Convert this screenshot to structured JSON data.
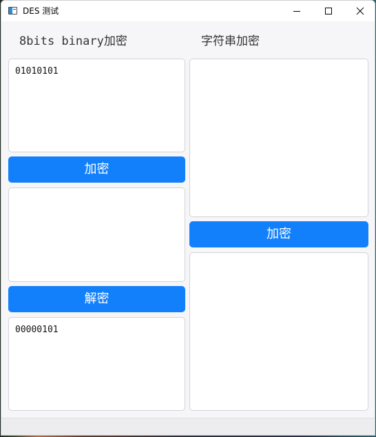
{
  "window": {
    "title": "DES 测试"
  },
  "binary_panel": {
    "heading": "8bits binary加密",
    "input_value": "01010101",
    "encrypt_button": "加密",
    "middle_value": "",
    "decrypt_button": "解密",
    "output_value": "00000101"
  },
  "string_panel": {
    "heading": "字符串加密",
    "input_value": "",
    "encrypt_button": "加密",
    "output_value": ""
  },
  "colors": {
    "button_blue": "#1380fb",
    "window_bg": "#f6f5f7"
  }
}
